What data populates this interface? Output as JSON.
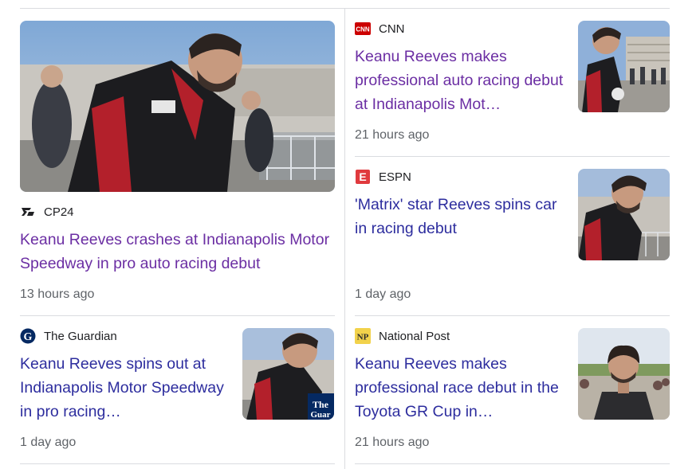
{
  "articles": [
    {
      "source": "CP24",
      "source_icon": "cp24-logo-icon",
      "title": "Keanu Reeves crashes at Indianapolis Motor Speedway in pro auto racing debut",
      "time": "13 hours ago"
    },
    {
      "source": "The Guardian",
      "source_icon": "guardian-logo-icon",
      "title": "Keanu Reeves spins out at Indianapolis Motor Speedway in pro racing…",
      "time": "1 day ago"
    },
    {
      "source": "CNN",
      "source_icon": "cnn-logo-icon",
      "source_logo_text": "CNN",
      "title": "Keanu Reeves makes professional auto racing debut at Indianapolis Mot…",
      "time": "21 hours ago"
    },
    {
      "source": "ESPN",
      "source_icon": "espn-logo-icon",
      "source_logo_text": "E",
      "title": "'Matrix' star Reeves spins car in racing debut",
      "time": "1 day ago"
    },
    {
      "source": "National Post",
      "source_icon": "national-post-logo-icon",
      "source_logo_text": "NP",
      "title": "Keanu Reeves makes professional race debut in the Toyota GR Cup in…",
      "time": "21 hours ago"
    }
  ],
  "colors": {
    "visited_link": "#6b2ea3",
    "unvisited_link": "#2d2d9e",
    "cnn_red": "#cc0000",
    "espn_red": "#e03a3e",
    "guardian_navy": "#052962",
    "national_post_yellow": "#f2d24b"
  }
}
